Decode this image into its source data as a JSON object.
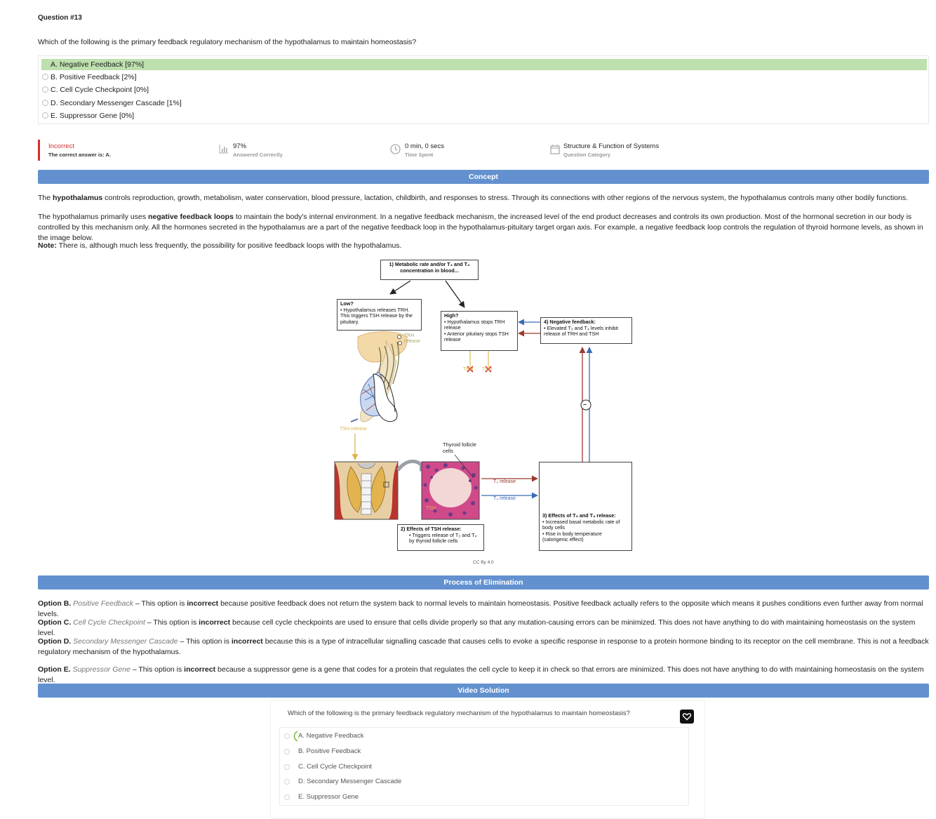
{
  "question": {
    "number": "Question #13",
    "text": "Which of the following is the primary feedback regulatory mechanism of the hypothalamus to maintain homeostasis?",
    "options": [
      {
        "label": "A. Negative Feedback [97%]",
        "correct": true
      },
      {
        "label": "B. Positive Feedback [2%]",
        "correct": false
      },
      {
        "label": "C. Cell Cycle Checkpoint [0%]",
        "correct": false
      },
      {
        "label": "D. Secondary Messenger Cascade [1%]",
        "correct": false
      },
      {
        "label": "E. Suppressor Gene [0%]",
        "correct": false
      }
    ]
  },
  "stats": {
    "result": {
      "title": "Incorrect",
      "subtitle": "The correct answer is: A."
    },
    "answered": {
      "title": "97%",
      "subtitle": "Answered Correctly",
      "icon": "bar-chart-icon"
    },
    "time": {
      "title": "0 min, 0 secs",
      "subtitle": "Time Spent",
      "icon": "clock-icon"
    },
    "category": {
      "title": "Structure & Function of Systems",
      "subtitle": "Question Category",
      "icon": "calendar-icon"
    }
  },
  "concept": {
    "heading": "Concept",
    "p1": {
      "before": "The ",
      "bold": "hypothalamus",
      "after": " controls reproduction, growth, metabolism, water conservation, blood pressure, lactation, childbirth, and responses to stress. Through its connections with other regions of the nervous system, the hypothalamus controls many other bodily functions."
    },
    "p2": {
      "before": "The hypothalamus primarily uses ",
      "bold": "negative feedback loops",
      "after": " to maintain the body's internal environment. In a negative feedback mechanism, the increased level of the end product decreases and controls its own production. Most of the hormonal secretion in our body is controlled by this mechanism only. All the hormones secreted in the hypothalamus are a part of the negative feedback loop in the hypothalamus-pituitary target organ axis. For example, a negative feedback loop controls the regulation of thyroid hormone levels, as shown in the image below."
    },
    "note": {
      "bold": "Note:",
      "after": " There is, although much less frequently, the possibility for positive feedback loops with the hypothalamus."
    }
  },
  "diagram": {
    "box1": "1) Metabolic rate and/or T₃ and T₄ concentration in blood...",
    "low_title": "Low?",
    "low_text": "• Hypothalamus releases TRH. This triggers TSH release by the pituitary.",
    "high_title": "High?",
    "high_text1": "• Hypothalamus stops TRH release",
    "high_text2": "• Anterior pituitary stops TSH release",
    "neg_title": "4) Negative feedback:",
    "neg_text": "• Elevated T₃ and T₄ levels inhibit release of TRH and TSH",
    "trh_release": "TRH release",
    "tsh_release": "TSH release",
    "trh_x": "TRH",
    "tsh_x": "TSH",
    "follicle": "Thyroid follicle cells",
    "t3_release": "T₃ release",
    "t4_release": "T₄ release",
    "tsh_inner": "TSH",
    "box2_title": "2) Effects of TSH release:",
    "box2_text": "• Triggers release of T₃ and T₄ by thyroid follicle cells",
    "box3_title": "3) Effects of T₃ and T₄ release:",
    "box3_text1": "• Increased basal metabolic rate of body cells",
    "box3_text2": "• Rise in body temperature (calorigenic effect)",
    "minus": "–",
    "license": "CC By 4.0"
  },
  "elimination": {
    "heading": "Process of Elimination",
    "items": [
      {
        "option": "Option B.",
        "name": "Positive Feedback",
        "mid": " – This option is ",
        "bold": "incorrect",
        "after": " because positive feedback does not return the system back to normal levels to maintain homeostasis. Positive feedback actually refers to the opposite which means it pushes conditions even further away from normal levels."
      },
      {
        "option": "Option C.",
        "name": "Cell Cycle Checkpoint",
        "mid": " – This option is ",
        "bold": "incorrect",
        "after": " because cell cycle checkpoints are used to ensure that cells divide properly so that any mutation-causing errors can be minimized. This does not have anything to do with maintaining homeostasis on the system level."
      },
      {
        "option": "Option D.",
        "name": "Secondary Messenger Cascade",
        "mid": " – This option is ",
        "bold": "incorrect",
        "after": " because this is a type of intracellular signalling cascade that causes cells to evoke a specific response in response to a protein hormone binding to its receptor on the cell membrane. This is not a feedback regulatory mechanism of the hypothalamus."
      },
      {
        "option": "Option E.",
        "name": "Suppressor Gene",
        "mid": " – This option is ",
        "bold": "incorrect",
        "after": " because a suppressor gene is a gene that codes for a protein that regulates the cell cycle to keep it in check so that errors are minimized. This does not have anything to do with maintaining homeostasis on the system level."
      }
    ]
  },
  "video": {
    "heading": "Video Solution",
    "question": "Which of the following is the primary feedback regulatory mechanism of the hypothalamus to maintain homeostasis?",
    "options": [
      "A. Negative Feedback",
      "B. Positive Feedback",
      "C. Cell Cycle Checkpoint",
      "D. Secondary Messenger Cascade",
      "E. Suppressor Gene"
    ]
  },
  "colors": {
    "correct_bg": "#bde0ae",
    "section_bar": "#6391cf",
    "incorrect": "#d32f2f"
  }
}
